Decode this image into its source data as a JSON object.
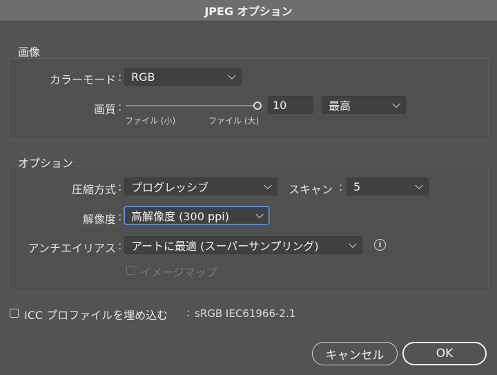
{
  "window": {
    "title": "JPEG オプション"
  },
  "image_group": {
    "title": "画像",
    "color_mode_label": "カラーモード",
    "color_mode_value": "RGB",
    "quality_label": "画質",
    "quality_slider_level": 1.0,
    "quality_value": "10",
    "quality_preset": "最高",
    "slider_min_label": "ファイル (小)",
    "slider_max_label": "ファイル (大)"
  },
  "options_group": {
    "title": "オプション",
    "compression_label": "圧縮方式",
    "compression_value": "プログレッシブ",
    "scan_label": "スキャン",
    "scan_value": "5",
    "resolution_label": "解像度",
    "resolution_value": "高解像度 (300 ppi)",
    "antialias_label": "アンチエイリアス",
    "antialias_value": "アートに最適 (スーパーサンプリング)",
    "image_map_label": "イメージマップ"
  },
  "icc": {
    "label": "ICC プロファイルを埋め込む",
    "value": "sRGB IEC61966-2.1"
  },
  "buttons": {
    "cancel": "キャンセル",
    "ok": "OK"
  },
  "colon": ":"
}
